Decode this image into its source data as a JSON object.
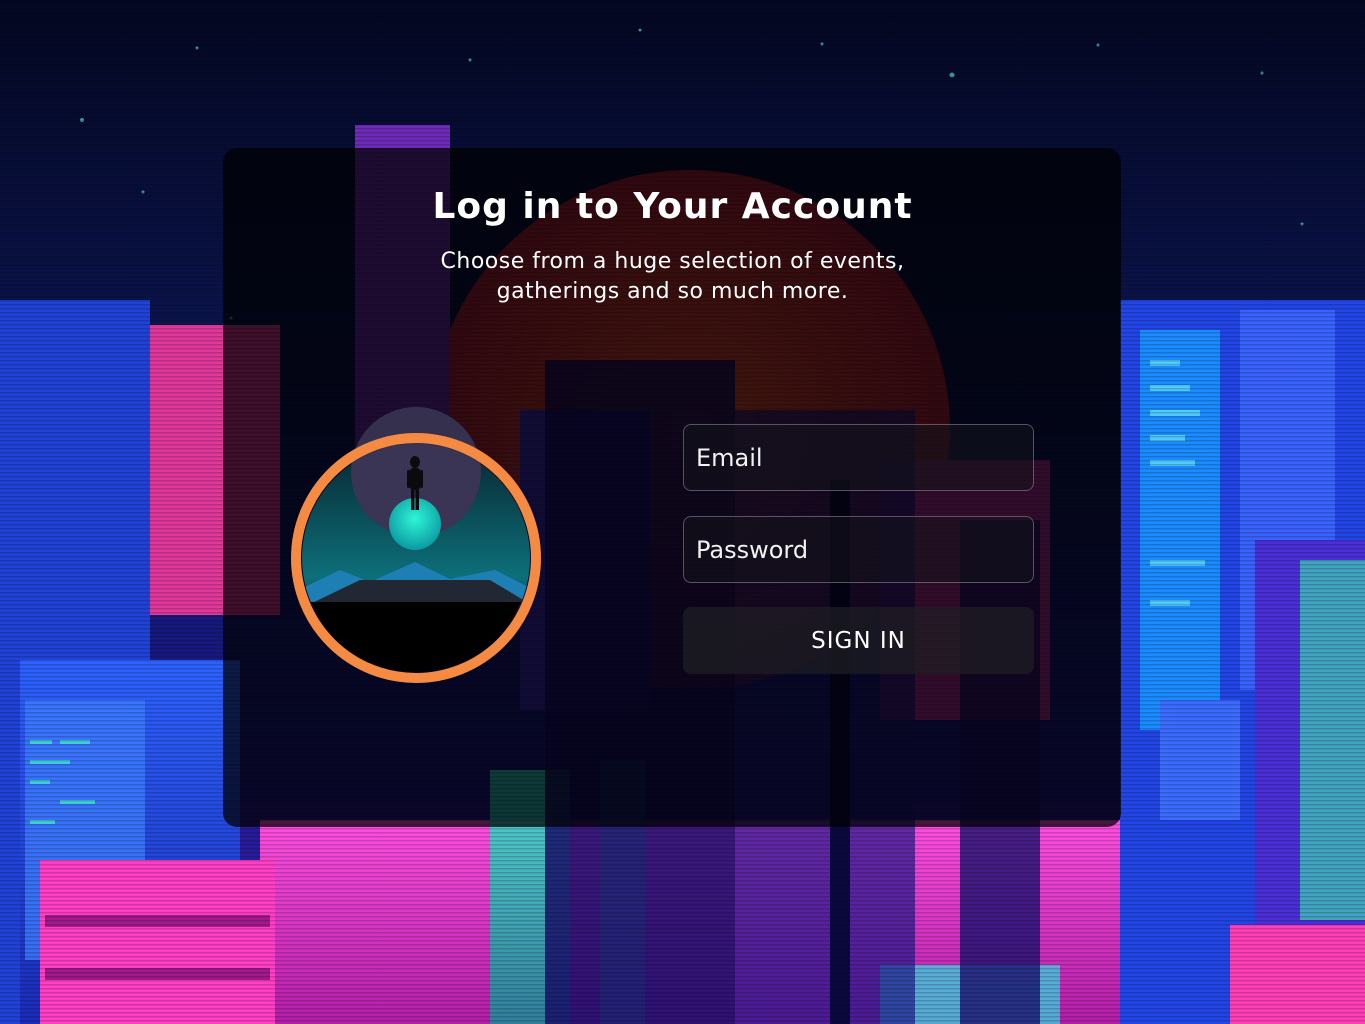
{
  "login": {
    "title": "Log in to Your Account",
    "subtitle": "Choose from a huge selection of events, gatherings and so much more.",
    "email_placeholder": "Email",
    "password_placeholder": "Password",
    "signin_label": "SIGN IN"
  },
  "theme": {
    "avatar_ring_color": "#f58a42",
    "orb_color": "#1fe0c8",
    "background_palette": [
      "#070a2a",
      "#2f4bff",
      "#ff38d4",
      "#27e0c4",
      "#d44a1f"
    ]
  },
  "icons": {
    "avatar": "alien-on-planet-illustration"
  }
}
